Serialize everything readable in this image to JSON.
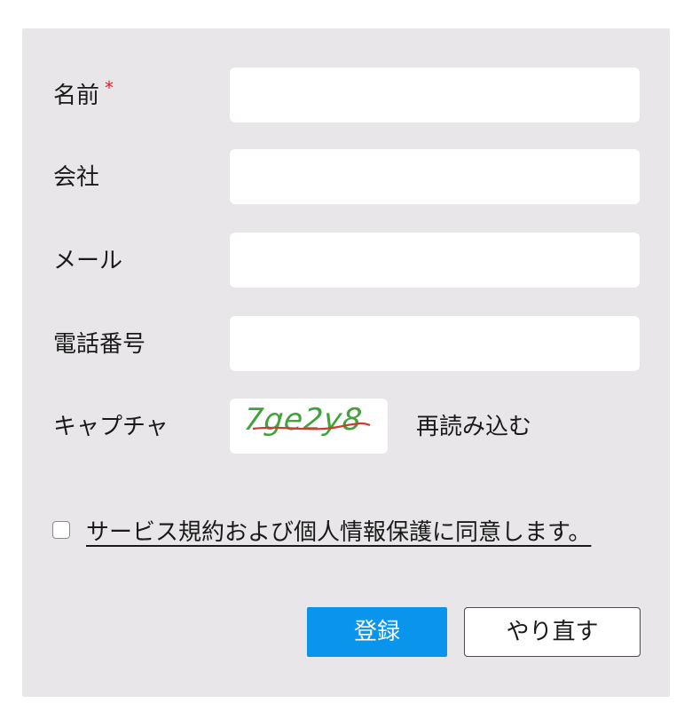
{
  "form": {
    "fields": [
      {
        "label": "名前",
        "required": true,
        "required_mark": "*",
        "value": ""
      },
      {
        "label": "会社",
        "required": false,
        "value": ""
      },
      {
        "label": "メール",
        "required": false,
        "value": ""
      },
      {
        "label": "電話番号",
        "required": false,
        "value": ""
      }
    ],
    "captcha": {
      "label": "キャプチャ",
      "image_text": "7ge2y8",
      "reload_label": "再読み込む"
    },
    "agreement": {
      "checked": false,
      "label": "サービス規約および個人情報保護に同意します。"
    },
    "buttons": {
      "submit_label": "登録",
      "reset_label": "やり直す"
    }
  },
  "colors": {
    "panel_bg": "#e8e6e8",
    "required_mark": "#e02424",
    "captcha_text": "#3fa33a",
    "captcha_strike": "#d13b2e",
    "primary_button": "#0a95ec"
  }
}
